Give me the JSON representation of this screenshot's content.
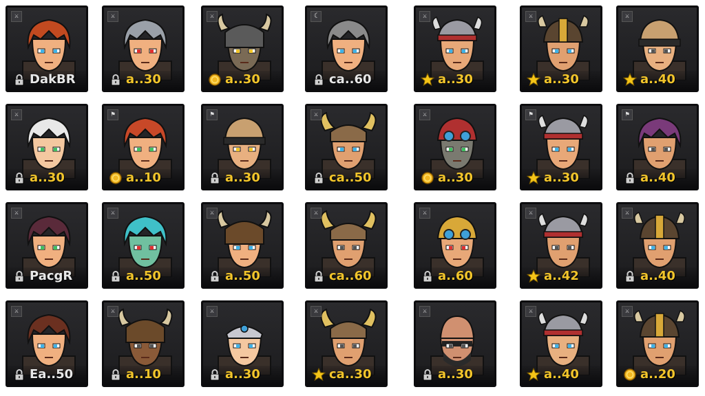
{
  "cards": [
    {
      "label": "DakBR",
      "badge": "lock",
      "label_color": "white",
      "hair": "#c24a20",
      "skin": "#f0b080",
      "eyes": "#3fb3e8",
      "helm": "none",
      "corner": "⚔"
    },
    {
      "label": "a..30",
      "badge": "lock",
      "label_color": "gold",
      "hair": "#9aa0a8",
      "skin": "#f0b080",
      "eyes": "#e03030",
      "helm": "none",
      "corner": "⚔"
    },
    {
      "label": "a..30",
      "badge": "coin",
      "label_color": "gold",
      "hair": "#444",
      "skin": "#7a6a55",
      "eyes": "#f2c52b",
      "helm": "horned",
      "corner": "⚔"
    },
    {
      "label": "ca..60",
      "badge": "lock",
      "label_color": "white",
      "hair": "#8a8a8a",
      "skin": "#f0b080",
      "eyes": "#3fb3e8",
      "helm": "none",
      "corner": "☾"
    },
    {
      "label": "a..30",
      "badge": "star",
      "label_color": "gold",
      "hair": "#b03030",
      "skin": "#e8a878",
      "eyes": "#3fb3e8",
      "helm": "viking",
      "corner": "⚔"
    },
    {
      "label": "a..30",
      "badge": "star",
      "label_color": "gold",
      "hair": "#6b4a2a",
      "skin": "#e0a070",
      "eyes": "#3fb3e8",
      "helm": "gold",
      "corner": "⚔"
    },
    {
      "label": "a..40",
      "badge": "star",
      "label_color": "gold",
      "hair": "#444",
      "skin": "#e8b080",
      "eyes": "#555",
      "helm": "band",
      "corner": "⚔"
    },
    {
      "label": "a..30",
      "badge": "lock",
      "label_color": "gold",
      "hair": "#e8e8e8",
      "skin": "#f4c8a0",
      "eyes": "#40c060",
      "helm": "none",
      "corner": "⚔"
    },
    {
      "label": "a..10",
      "badge": "coin",
      "label_color": "gold",
      "hair": "#c84828",
      "skin": "#f0b080",
      "eyes": "#40c060",
      "helm": "none",
      "corner": "⚑"
    },
    {
      "label": "a..30",
      "badge": "lock",
      "label_color": "gold",
      "hair": "#c8a060",
      "skin": "#e8b080",
      "eyes": "#f2c52b",
      "helm": "band",
      "corner": "⚑"
    },
    {
      "label": "ca..50",
      "badge": "lock",
      "label_color": "gold",
      "hair": "#c8c8c8",
      "skin": "#e0a070",
      "eyes": "#3fb3e8",
      "helm": "horned-light",
      "corner": "⚔"
    },
    {
      "label": "a..30",
      "badge": "coin",
      "label_color": "gold",
      "hair": "#b03030",
      "skin": "#7a7a70",
      "eyes": "#40c060",
      "helm": "goggle",
      "corner": "⚔"
    },
    {
      "label": "a..30",
      "badge": "star",
      "label_color": "gold",
      "hair": "#888",
      "skin": "#e8a878",
      "eyes": "#3fb3e8",
      "helm": "viking",
      "corner": "⚑"
    },
    {
      "label": "a..40",
      "badge": "lock",
      "label_color": "gold",
      "hair": "#7a3a7a",
      "skin": "#e0a070",
      "eyes": "#555",
      "helm": "none",
      "corner": "⚑"
    },
    {
      "label": "PacgR",
      "badge": "lock",
      "label_color": "white",
      "hair": "#5a2a3a",
      "skin": "#f0b080",
      "eyes": "#40c060",
      "helm": "none",
      "corner": "⚔"
    },
    {
      "label": "a..50",
      "badge": "lock",
      "label_color": "gold",
      "hair": "#3fc0c8",
      "skin": "#70c0a0",
      "eyes": "#e03030",
      "helm": "none",
      "corner": "⚔"
    },
    {
      "label": "a..50",
      "badge": "lock",
      "label_color": "gold",
      "hair": "#6b4a2a",
      "skin": "#f0b080",
      "eyes": "#3fb3e8",
      "helm": "horned-dark",
      "corner": "⚔"
    },
    {
      "label": "ca..60",
      "badge": "lock",
      "label_color": "gold",
      "hair": "#8a6040",
      "skin": "#e0a070",
      "eyes": "#555",
      "helm": "horned-light",
      "corner": "⚔"
    },
    {
      "label": "a..60",
      "badge": "lock",
      "label_color": "gold",
      "hair": "#b03030",
      "skin": "#e8a878",
      "eyes": "#e03030",
      "helm": "goggle-gold",
      "corner": "⚔"
    },
    {
      "label": "a..42",
      "badge": "star",
      "label_color": "gold",
      "hair": "#888",
      "skin": "#e0a070",
      "eyes": "#555",
      "helm": "viking",
      "corner": "⚔"
    },
    {
      "label": "a..40",
      "badge": "lock",
      "label_color": "gold",
      "hair": "#6b4a2a",
      "skin": "#e0a070",
      "eyes": "#3fb3e8",
      "helm": "gold",
      "corner": "⚔"
    },
    {
      "label": "Ea..50",
      "badge": "lock",
      "label_color": "white",
      "hair": "#6b3020",
      "skin": "#f0b080",
      "eyes": "#3fb3e8",
      "helm": "none",
      "corner": "⚔"
    },
    {
      "label": "a..10",
      "badge": "lock",
      "label_color": "gold",
      "hair": "#777",
      "skin": "#8a5a38",
      "eyes": "#555",
      "helm": "horned-dark",
      "corner": "⚔"
    },
    {
      "label": "a..30",
      "badge": "lock",
      "label_color": "gold",
      "hair": "#f0d060",
      "skin": "#f4c8a0",
      "eyes": "#3fb3e8",
      "helm": "tiara",
      "corner": "⚔"
    },
    {
      "label": "ca..30",
      "badge": "star",
      "label_color": "gold",
      "hair": "#d0d0d0",
      "skin": "#e0a070",
      "eyes": "#555",
      "helm": "horned-light",
      "corner": "⚔"
    },
    {
      "label": "a..30",
      "badge": "lock",
      "label_color": "gold",
      "hair": "#333",
      "skin": "#d09070",
      "eyes": "#555",
      "helm": "bald",
      "corner": "⚔"
    },
    {
      "label": "a..40",
      "badge": "star",
      "label_color": "gold",
      "hair": "#888",
      "skin": "#e8b080",
      "eyes": "#3fb3e8",
      "helm": "viking",
      "corner": "⚔"
    },
    {
      "label": "a..20",
      "badge": "coin",
      "label_color": "gold",
      "hair": "#6b4a2a",
      "skin": "#e0a070",
      "eyes": "#3fb3e8",
      "helm": "gold",
      "corner": "⚔"
    }
  ]
}
